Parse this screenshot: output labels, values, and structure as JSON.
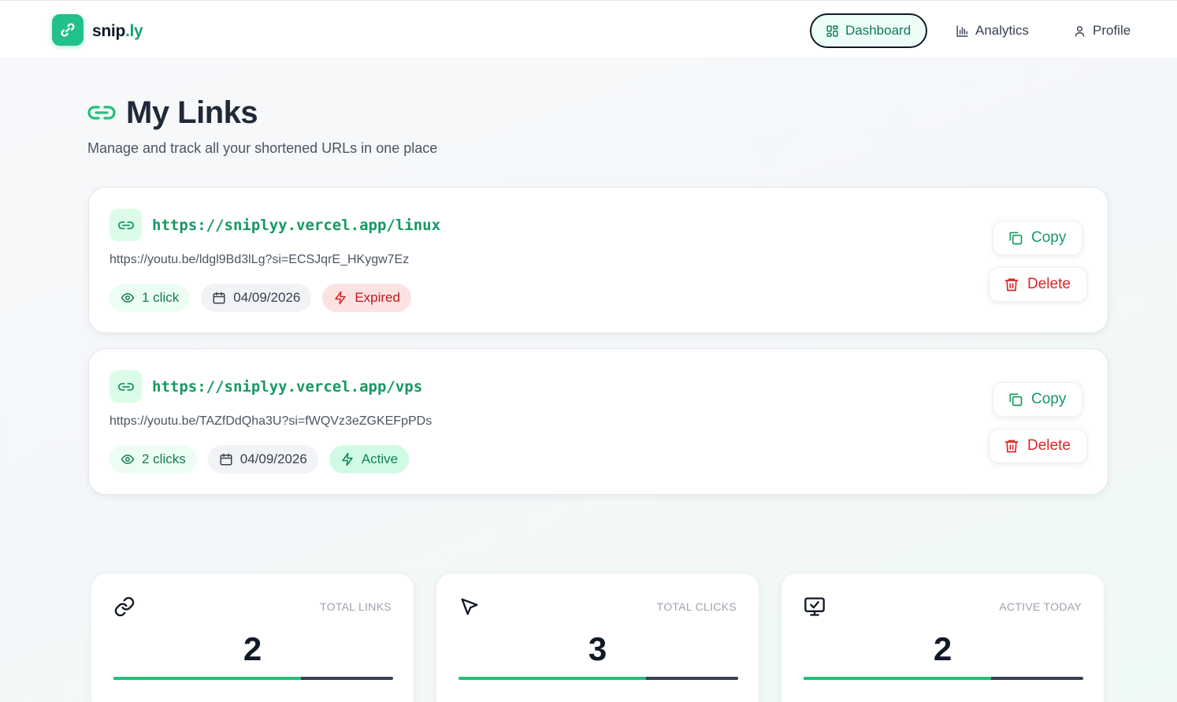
{
  "brand": {
    "name_main": "snip",
    "name_accent": ".ly",
    "color": "#22c08a"
  },
  "nav": {
    "items": [
      {
        "label": "Dashboard",
        "icon": "dashboard-grid-icon",
        "active": true
      },
      {
        "label": "Analytics",
        "icon": "bar-chart-icon",
        "active": false
      },
      {
        "label": "Profile",
        "icon": "user-icon",
        "active": false
      }
    ]
  },
  "page": {
    "title": "My Links",
    "subtitle": "Manage and track all your shortened URLs in one place"
  },
  "links": [
    {
      "short_url": "https://sniplyy.vercel.app/linux",
      "original_url": "https://youtu.be/ldgl9Bd3lLg?si=ECSJqrE_HKygw7Ez",
      "clicks": "1 click",
      "date": "04/09/2026",
      "status": "Expired",
      "copy_label": "Copy",
      "delete_label": "Delete"
    },
    {
      "short_url": "https://sniplyy.vercel.app/vps",
      "original_url": "https://youtu.be/TAZfDdQha3U?si=fWQVz3eZGKEFpPDs",
      "clicks": "2 clicks",
      "date": "04/09/2026",
      "status": "Active",
      "copy_label": "Copy",
      "delete_label": "Delete"
    }
  ],
  "stats": [
    {
      "label": "TOTAL LINKS",
      "value": "2",
      "icon": "link-icon",
      "progress": 0.67
    },
    {
      "label": "TOTAL CLICKS",
      "value": "3",
      "icon": "cursor-pointer-icon",
      "progress": 0.67
    },
    {
      "label": "ACTIVE TODAY",
      "value": "2",
      "icon": "monitor-check-icon",
      "progress": 0.67
    }
  ],
  "colors": {
    "accent": "#169963",
    "danger": "#dc2626",
    "expired_bg": "#fde2e2",
    "active_bg": "#d1fae5"
  }
}
